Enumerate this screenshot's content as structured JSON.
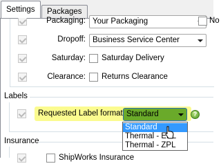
{
  "tabs": [
    {
      "label": "Settings",
      "active": true
    },
    {
      "label": "Packages",
      "active": false
    }
  ],
  "rows": {
    "packaging": {
      "label": "Packaging:",
      "value": "Your Packaging",
      "extra_checkbox_label": "No"
    },
    "dropoff": {
      "label": "Dropoff:",
      "value": "Business Service Center"
    },
    "saturday": {
      "label": "Saturday:",
      "checkbox_label": "Saturday Delivery"
    },
    "clearance": {
      "label": "Clearance:",
      "checkbox_label": "Returns Clearance"
    }
  },
  "labels_group": {
    "title": "Labels",
    "format_label": "Requested Label format:",
    "format_value": "Standard",
    "help_icon": "help-icon",
    "highlight_color": "#fbfb8f",
    "options": [
      "Standard",
      "Thermal - EPL",
      "Thermal - ZPL"
    ],
    "selected_option": "Standard"
  },
  "insurance_group": {
    "title": "Insurance",
    "checkbox_label": "ShipWorks Insurance"
  },
  "colors": {
    "selection": "#3399ff",
    "active_combo": "#6aaa2a"
  }
}
